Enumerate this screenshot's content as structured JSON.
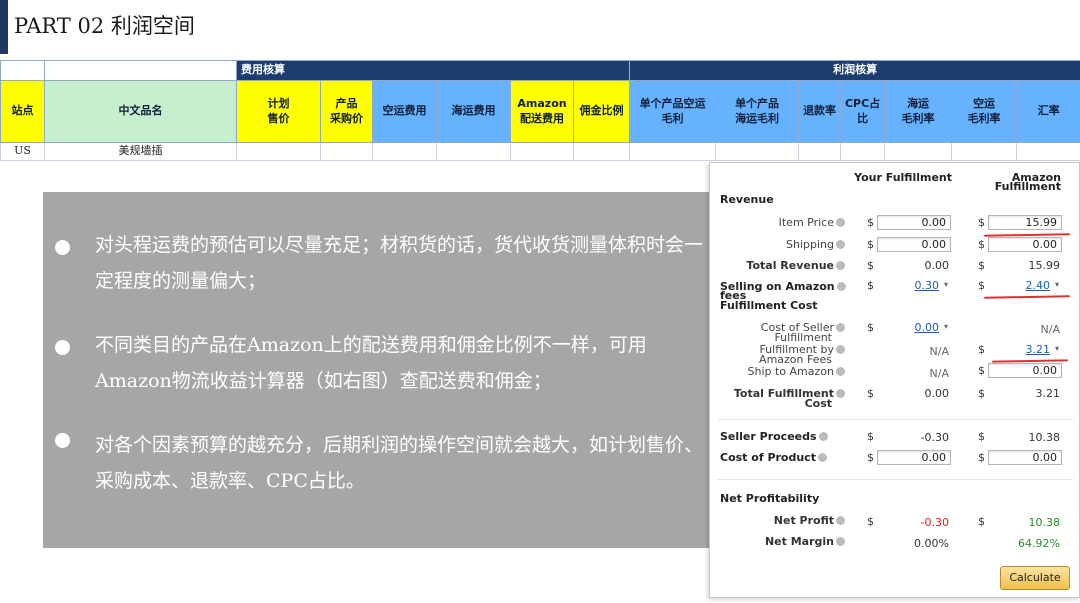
{
  "header": {
    "title": "PART  02    利润空间"
  },
  "table": {
    "group_headers": {
      "cost": "费用核算",
      "profit": "利润核算"
    },
    "columns": {
      "site": "站点",
      "name": "中文品名",
      "price": "计划\n售价",
      "purchase": "产品\n采购价",
      "air": "空运费用",
      "sea": "海运费用",
      "amazon_ship": "Amazon\n配送费用",
      "commission": "佣金比例",
      "unit_air": "单个产品空运\n毛利",
      "unit_sea": "单个产品\n海运毛利",
      "refund": "退款率",
      "cpc": "CPC占\n比",
      "sea_margin": "海运\n毛利率",
      "air_margin": "空运\n毛利率",
      "fx": "汇率"
    },
    "row": {
      "site": "US",
      "name": "美规墙插"
    }
  },
  "bullets": [
    "对头程运费的预估可以尽量充足；材积货的话，货代收货测量体积时会一定程度的测量偏大；",
    "不同类目的产品在Amazon上的配送费用和佣金比例不一样，可用Amazon物流收益计算器（如右图）查配送费和佣金；",
    "对各个因素预算的越充分，后期利润的操作空间就会越大，如计划售价、采购成本、退款率、CPC占比。"
  ],
  "calculator": {
    "col_your": "Your Fulfillment",
    "col_amazon_1": "Amazon",
    "col_amazon_2": "Fulfillment",
    "currency": "$",
    "section_revenue": "Revenue",
    "item_price": {
      "label": "Item Price",
      "your": "0.00",
      "amazon": "15.99"
    },
    "shipping": {
      "label": "Shipping",
      "your": "0.00",
      "amazon": "0.00"
    },
    "total_revenue": {
      "label": "Total Revenue",
      "your": "0.00",
      "amazon": "15.99"
    },
    "selling_fees": {
      "label_1": "Selling on Amazon",
      "label_2": "fees",
      "your": "0.30",
      "amazon": "2.40"
    },
    "section_fulfillment": "Fulfillment Cost",
    "cost_seller": {
      "label_1": "Cost of Seller",
      "label_2": "Fulfillment",
      "your": "0.00",
      "amazon": "N/A"
    },
    "fba_fees": {
      "label_1": "Fulfillment by",
      "label_2": "Amazon Fees",
      "your": "N/A",
      "amazon": "3.21"
    },
    "ship_to_amazon": {
      "label": "Ship to Amazon",
      "your": "N/A",
      "amazon": "0.00"
    },
    "total_fulfillment": {
      "label_1": "Total Fulfillment",
      "label_2": "Cost",
      "your": "0.00",
      "amazon": "3.21"
    },
    "seller_proceeds": {
      "label": "Seller Proceeds",
      "your": "-0.30",
      "amazon": "10.38"
    },
    "cost_of_product": {
      "label": "Cost of Product",
      "your": "0.00",
      "amazon": "0.00"
    },
    "section_net": "Net Profitability",
    "net_profit": {
      "label": "Net Profit",
      "your": "-0.30",
      "amazon": "10.38"
    },
    "net_margin": {
      "label": "Net Margin",
      "your": "0.00%",
      "amazon": "64.92%"
    },
    "calculate_label": "Calculate"
  },
  "colors": {
    "navy": "#1f3c6e",
    "yellow": "#ffff00",
    "green": "#c6efce",
    "blue": "#66b2ff",
    "panel_grey": "#a6a6a6",
    "negative": "#d42020",
    "positive": "#2a8a2a",
    "link": "#1a5fb4"
  }
}
